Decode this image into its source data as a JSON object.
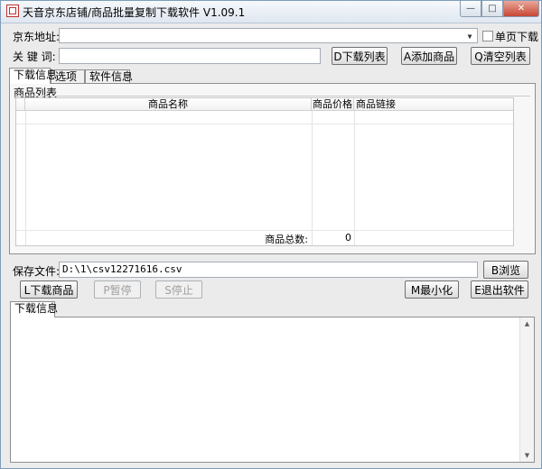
{
  "window": {
    "title": "天音京东店铺/商品批量复制下载软件 V1.09.1",
    "controls": {
      "minimize": "—",
      "maximize": "□",
      "close": "✕"
    }
  },
  "form": {
    "url_label": "京东地址:",
    "url_value": "",
    "single_page_label": "单页下载",
    "keyword_label": "关 键 词:",
    "keyword_value": "",
    "buttons": {
      "download_list": "D下载列表",
      "add_product": "A添加商品",
      "clear_list": "Q清空列表"
    }
  },
  "tabs": [
    {
      "label": "下载信息",
      "active": true
    },
    {
      "label": "选项",
      "active": false
    },
    {
      "label": "软件信息",
      "active": false
    }
  ],
  "product_list": {
    "group_label": "商品列表",
    "columns": [
      "商品名称",
      "商品价格",
      "商品链接"
    ],
    "footer_label": "商品总数:",
    "footer_count": "0"
  },
  "save": {
    "label": "保存文件:",
    "path": "D:\\1\\csv12271616.csv",
    "browse": "B浏览"
  },
  "actions": {
    "download": "L下载商品",
    "pause": "P暂停",
    "stop": "S停止",
    "minimize": "M最小化",
    "exit": "E退出软件"
  },
  "log": {
    "tab_label": "下载信息",
    "content": ""
  }
}
